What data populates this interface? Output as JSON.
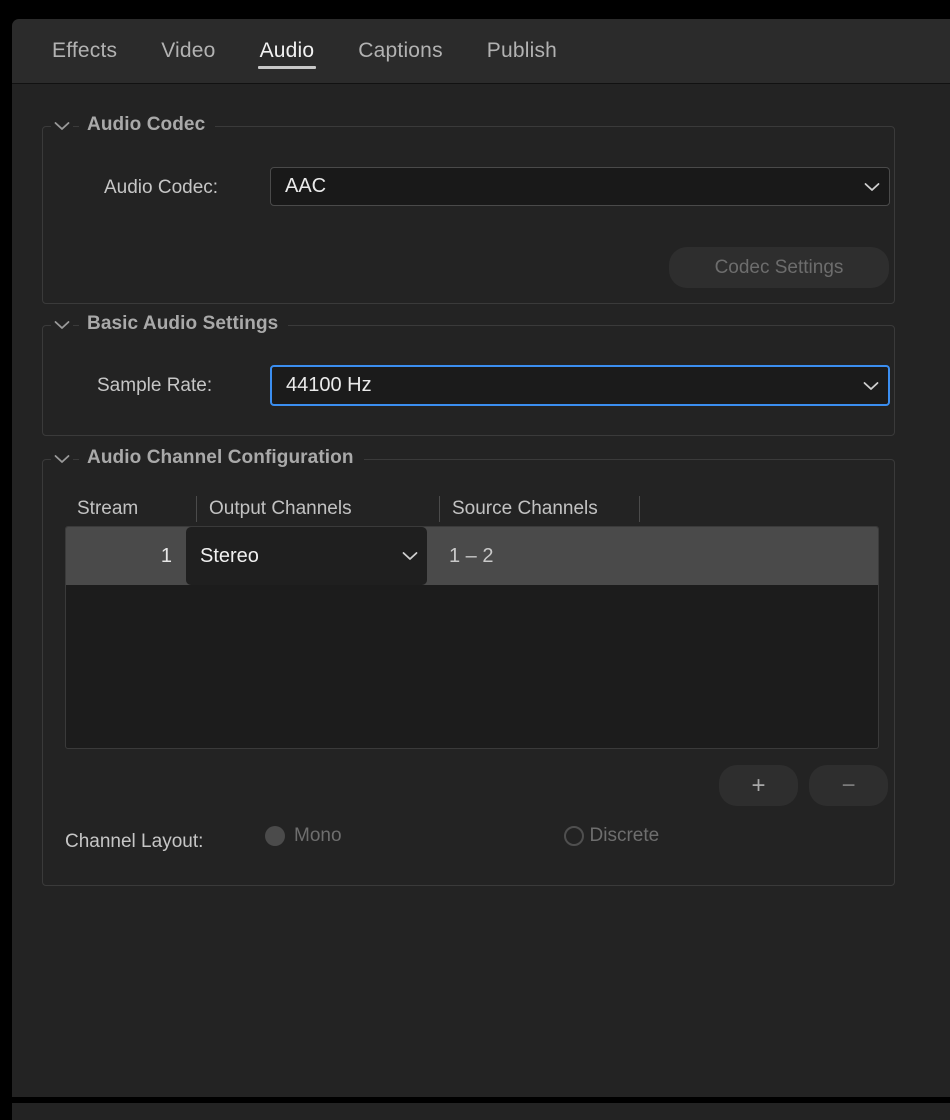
{
  "tabs": [
    {
      "label": "Effects",
      "active": false
    },
    {
      "label": "Video",
      "active": false
    },
    {
      "label": "Audio",
      "active": true
    },
    {
      "label": "Captions",
      "active": false
    },
    {
      "label": "Publish",
      "active": false
    }
  ],
  "sections": {
    "audio_codec": {
      "title": "Audio Codec",
      "chevron": "chevron-down-icon",
      "codec_label": "Audio Codec:",
      "codec_value": "AAC",
      "codec_settings_button": "Codec Settings"
    },
    "basic_audio": {
      "title": "Basic Audio Settings",
      "chevron": "chevron-down-icon",
      "sample_rate_label": "Sample Rate:",
      "sample_rate_value": "44100 Hz"
    },
    "channel_config": {
      "title": "Audio Channel Configuration",
      "chevron": "chevron-down-icon",
      "columns": [
        "Stream",
        "Output Channels",
        "Source Channels"
      ],
      "rows": [
        {
          "stream": "1",
          "output_channels": "Stereo",
          "source_channels": "1 – 2"
        }
      ],
      "add_button": "+",
      "remove_button": "−",
      "channel_layout_label": "Channel Layout:",
      "layout_options": [
        {
          "label": "Mono",
          "state": "filled"
        },
        {
          "label": "Discrete",
          "state": "ring"
        }
      ]
    }
  },
  "colors": {
    "panel_bg": "#232323",
    "tabbar_bg": "#2b2b2b",
    "accent_focus": "#3b8ef0",
    "section_border": "#3a3a3a",
    "row_selected": "#4a4a4a",
    "field_bg": "#191919"
  }
}
